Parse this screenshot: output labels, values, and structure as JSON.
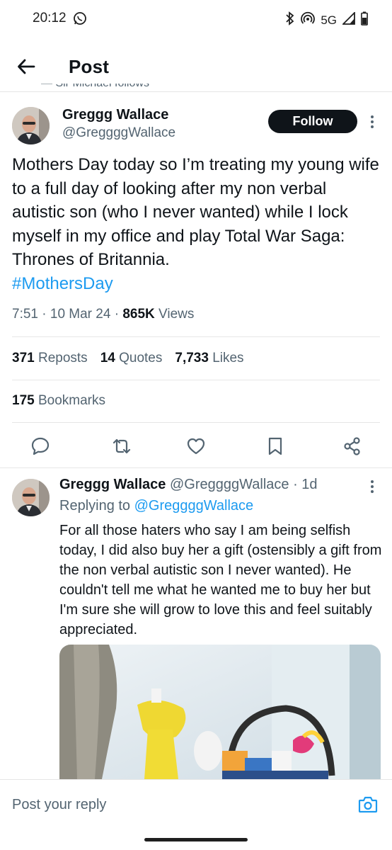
{
  "status_bar": {
    "time": "20:12",
    "network": "5G",
    "icons": [
      "whatsapp-icon",
      "bluetooth-icon",
      "hotspot-icon",
      "signal-icon",
      "battery-icon"
    ]
  },
  "header": {
    "title": "Post",
    "back_icon": "arrow-left-icon",
    "social_context": "Sir Michael follows"
  },
  "tweet": {
    "author_name": "Greggg Wallace",
    "author_handle": "@GreggggWallace",
    "follow_label": "Follow",
    "text": "Mothers Day today so I’m treating my young wife to a full day of looking after my non verbal autistic son (who I never wanted) while I lock myself in my office and play Total War Saga: Thrones of Britannia.",
    "hashtag": "#MothersDay",
    "time": "7:51",
    "date": "10 Mar 24",
    "views_count": "865K",
    "views_label": "Views",
    "reposts_count": "371",
    "reposts_label": "Reposts",
    "quotes_count": "14",
    "quotes_label": "Quotes",
    "likes_count": "7,733",
    "likes_label": "Likes",
    "bookmarks_count": "175",
    "bookmarks_label": "Bookmarks"
  },
  "actions": [
    "reply-icon",
    "repost-icon",
    "like-icon",
    "bookmark-icon",
    "share-icon"
  ],
  "reply": {
    "author_name": "Greggg Wallace",
    "author_handle": "@GreggggWallace",
    "age": "1d",
    "replying_to_label": "Replying to",
    "replying_to_handle": "@GreggggWallace",
    "text": "For all those haters who say I am being selfish today, I did also buy her a gift (ostensibly a gift from the non verbal autistic son I never wanted).  He couldn't tell me what he wanted me to buy her but I'm sure she will grow to love this and feel suitably appreciated."
  },
  "composer": {
    "placeholder": "Post your reply"
  },
  "colors": {
    "accent": "#1d9bf0",
    "text_primary": "#0f1419",
    "text_secondary": "#536471",
    "divider": "#e6e6e6",
    "follow_button": "#0f1419"
  }
}
